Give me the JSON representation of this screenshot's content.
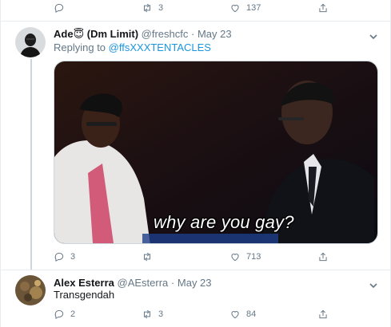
{
  "top_actions": {
    "reply_count": "",
    "retweet_count": "3",
    "like_count": "137"
  },
  "tweet1": {
    "author_name": "Ade",
    "author_emoji": "😇",
    "author_suffix": "(Dm Limit)",
    "handle": "@freshcfc",
    "separator": "·",
    "date": "May 23",
    "replying_prefix": "Replying to",
    "replying_to": "@ffsXXXTENTACLES",
    "media_caption": "why are you gay?",
    "actions": {
      "reply_count": "3",
      "retweet_count": "",
      "like_count": "713"
    }
  },
  "tweet2": {
    "author_name": "Alex Esterra",
    "handle": "@AEsterra",
    "separator": "·",
    "date": "May 23",
    "text": "Transgendah",
    "actions": {
      "reply_count": "2",
      "retweet_count": "3",
      "like_count": "84"
    }
  }
}
